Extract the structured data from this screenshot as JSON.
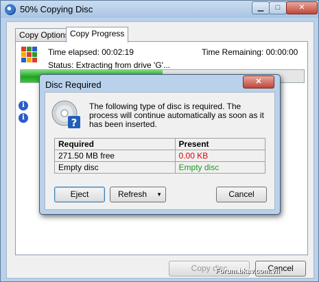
{
  "window": {
    "title": "50% Copying Disc"
  },
  "tabs": [
    {
      "label": "Copy Options"
    },
    {
      "label": "Copy Progress"
    }
  ],
  "progress": {
    "time_elapsed": "Time elapsed: 00:02:19",
    "time_remaining": "Time Remaining: 00:00:00",
    "status": "Status: Extracting from drive 'G'...",
    "fraction": 0.5
  },
  "buttons": {
    "copy_disc": "Copy disc",
    "cancel": "Cancel"
  },
  "dialog": {
    "title": "Disc Required",
    "message": "The following type of disc is required. The process will continue automatically as soon as it has been inserted.",
    "table": {
      "headers": [
        "Required",
        "Present"
      ],
      "rows": [
        {
          "required": "271.50 MB free",
          "present": "0.00 KB",
          "present_color": "#e00000"
        },
        {
          "required": "Empty disc",
          "present": "Empty disc",
          "present_color": "#1a9a1a"
        }
      ]
    },
    "buttons": {
      "eject": "Eject",
      "refresh": "Refresh",
      "cancel": "Cancel"
    }
  },
  "watermark": "Forum.bkav.com.vn"
}
